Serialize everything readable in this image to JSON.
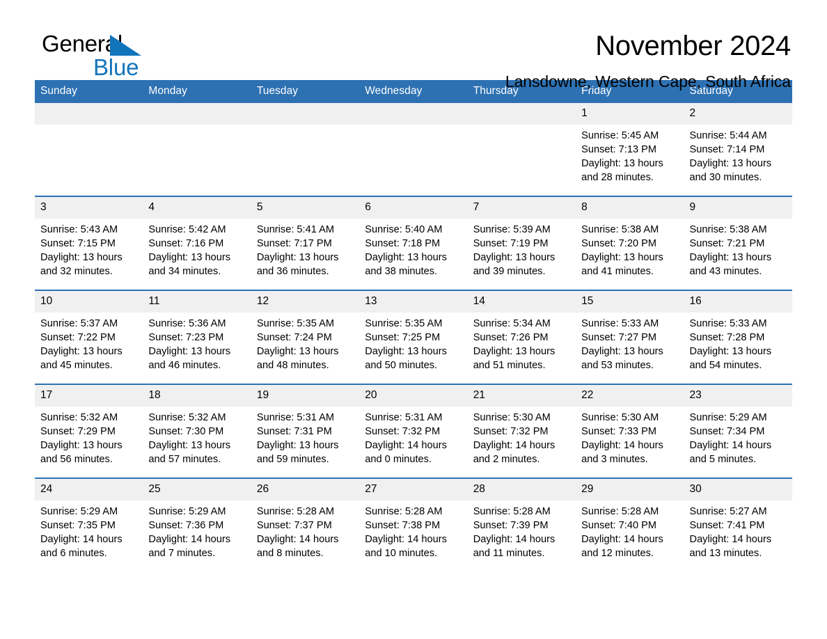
{
  "brand": {
    "line1": "General",
    "line2": "Blue",
    "accent_color": "#1274bb",
    "triangle_icon": "triangle-icon"
  },
  "header": {
    "title": "November 2024",
    "location": "Lansdowne, Western Cape, South Africa"
  },
  "theme": {
    "header_blue": "#2d71b2",
    "daynum_bg": "#f0f0f0",
    "text": "#000000"
  },
  "calendar": {
    "weekday_headers": [
      "Sunday",
      "Monday",
      "Tuesday",
      "Wednesday",
      "Thursday",
      "Friday",
      "Saturday"
    ],
    "weeks": [
      [
        {
          "day": "",
          "empty": true,
          "sunrise": "",
          "sunset": "",
          "daylight": ""
        },
        {
          "day": "",
          "empty": true,
          "sunrise": "",
          "sunset": "",
          "daylight": ""
        },
        {
          "day": "",
          "empty": true,
          "sunrise": "",
          "sunset": "",
          "daylight": ""
        },
        {
          "day": "",
          "empty": true,
          "sunrise": "",
          "sunset": "",
          "daylight": ""
        },
        {
          "day": "",
          "empty": true,
          "sunrise": "",
          "sunset": "",
          "daylight": ""
        },
        {
          "day": "1",
          "empty": false,
          "sunrise": "Sunrise: 5:45 AM",
          "sunset": "Sunset: 7:13 PM",
          "daylight": "Daylight: 13 hours and 28 minutes."
        },
        {
          "day": "2",
          "empty": false,
          "sunrise": "Sunrise: 5:44 AM",
          "sunset": "Sunset: 7:14 PM",
          "daylight": "Daylight: 13 hours and 30 minutes."
        }
      ],
      [
        {
          "day": "3",
          "empty": false,
          "sunrise": "Sunrise: 5:43 AM",
          "sunset": "Sunset: 7:15 PM",
          "daylight": "Daylight: 13 hours and 32 minutes."
        },
        {
          "day": "4",
          "empty": false,
          "sunrise": "Sunrise: 5:42 AM",
          "sunset": "Sunset: 7:16 PM",
          "daylight": "Daylight: 13 hours and 34 minutes."
        },
        {
          "day": "5",
          "empty": false,
          "sunrise": "Sunrise: 5:41 AM",
          "sunset": "Sunset: 7:17 PM",
          "daylight": "Daylight: 13 hours and 36 minutes."
        },
        {
          "day": "6",
          "empty": false,
          "sunrise": "Sunrise: 5:40 AM",
          "sunset": "Sunset: 7:18 PM",
          "daylight": "Daylight: 13 hours and 38 minutes."
        },
        {
          "day": "7",
          "empty": false,
          "sunrise": "Sunrise: 5:39 AM",
          "sunset": "Sunset: 7:19 PM",
          "daylight": "Daylight: 13 hours and 39 minutes."
        },
        {
          "day": "8",
          "empty": false,
          "sunrise": "Sunrise: 5:38 AM",
          "sunset": "Sunset: 7:20 PM",
          "daylight": "Daylight: 13 hours and 41 minutes."
        },
        {
          "day": "9",
          "empty": false,
          "sunrise": "Sunrise: 5:38 AM",
          "sunset": "Sunset: 7:21 PM",
          "daylight": "Daylight: 13 hours and 43 minutes."
        }
      ],
      [
        {
          "day": "10",
          "empty": false,
          "sunrise": "Sunrise: 5:37 AM",
          "sunset": "Sunset: 7:22 PM",
          "daylight": "Daylight: 13 hours and 45 minutes."
        },
        {
          "day": "11",
          "empty": false,
          "sunrise": "Sunrise: 5:36 AM",
          "sunset": "Sunset: 7:23 PM",
          "daylight": "Daylight: 13 hours and 46 minutes."
        },
        {
          "day": "12",
          "empty": false,
          "sunrise": "Sunrise: 5:35 AM",
          "sunset": "Sunset: 7:24 PM",
          "daylight": "Daylight: 13 hours and 48 minutes."
        },
        {
          "day": "13",
          "empty": false,
          "sunrise": "Sunrise: 5:35 AM",
          "sunset": "Sunset: 7:25 PM",
          "daylight": "Daylight: 13 hours and 50 minutes."
        },
        {
          "day": "14",
          "empty": false,
          "sunrise": "Sunrise: 5:34 AM",
          "sunset": "Sunset: 7:26 PM",
          "daylight": "Daylight: 13 hours and 51 minutes."
        },
        {
          "day": "15",
          "empty": false,
          "sunrise": "Sunrise: 5:33 AM",
          "sunset": "Sunset: 7:27 PM",
          "daylight": "Daylight: 13 hours and 53 minutes."
        },
        {
          "day": "16",
          "empty": false,
          "sunrise": "Sunrise: 5:33 AM",
          "sunset": "Sunset: 7:28 PM",
          "daylight": "Daylight: 13 hours and 54 minutes."
        }
      ],
      [
        {
          "day": "17",
          "empty": false,
          "sunrise": "Sunrise: 5:32 AM",
          "sunset": "Sunset: 7:29 PM",
          "daylight": "Daylight: 13 hours and 56 minutes."
        },
        {
          "day": "18",
          "empty": false,
          "sunrise": "Sunrise: 5:32 AM",
          "sunset": "Sunset: 7:30 PM",
          "daylight": "Daylight: 13 hours and 57 minutes."
        },
        {
          "day": "19",
          "empty": false,
          "sunrise": "Sunrise: 5:31 AM",
          "sunset": "Sunset: 7:31 PM",
          "daylight": "Daylight: 13 hours and 59 minutes."
        },
        {
          "day": "20",
          "empty": false,
          "sunrise": "Sunrise: 5:31 AM",
          "sunset": "Sunset: 7:32 PM",
          "daylight": "Daylight: 14 hours and 0 minutes."
        },
        {
          "day": "21",
          "empty": false,
          "sunrise": "Sunrise: 5:30 AM",
          "sunset": "Sunset: 7:32 PM",
          "daylight": "Daylight: 14 hours and 2 minutes."
        },
        {
          "day": "22",
          "empty": false,
          "sunrise": "Sunrise: 5:30 AM",
          "sunset": "Sunset: 7:33 PM",
          "daylight": "Daylight: 14 hours and 3 minutes."
        },
        {
          "day": "23",
          "empty": false,
          "sunrise": "Sunrise: 5:29 AM",
          "sunset": "Sunset: 7:34 PM",
          "daylight": "Daylight: 14 hours and 5 minutes."
        }
      ],
      [
        {
          "day": "24",
          "empty": false,
          "sunrise": "Sunrise: 5:29 AM",
          "sunset": "Sunset: 7:35 PM",
          "daylight": "Daylight: 14 hours and 6 minutes."
        },
        {
          "day": "25",
          "empty": false,
          "sunrise": "Sunrise: 5:29 AM",
          "sunset": "Sunset: 7:36 PM",
          "daylight": "Daylight: 14 hours and 7 minutes."
        },
        {
          "day": "26",
          "empty": false,
          "sunrise": "Sunrise: 5:28 AM",
          "sunset": "Sunset: 7:37 PM",
          "daylight": "Daylight: 14 hours and 8 minutes."
        },
        {
          "day": "27",
          "empty": false,
          "sunrise": "Sunrise: 5:28 AM",
          "sunset": "Sunset: 7:38 PM",
          "daylight": "Daylight: 14 hours and 10 minutes."
        },
        {
          "day": "28",
          "empty": false,
          "sunrise": "Sunrise: 5:28 AM",
          "sunset": "Sunset: 7:39 PM",
          "daylight": "Daylight: 14 hours and 11 minutes."
        },
        {
          "day": "29",
          "empty": false,
          "sunrise": "Sunrise: 5:28 AM",
          "sunset": "Sunset: 7:40 PM",
          "daylight": "Daylight: 14 hours and 12 minutes."
        },
        {
          "day": "30",
          "empty": false,
          "sunrise": "Sunrise: 5:27 AM",
          "sunset": "Sunset: 7:41 PM",
          "daylight": "Daylight: 14 hours and 13 minutes."
        }
      ]
    ]
  }
}
